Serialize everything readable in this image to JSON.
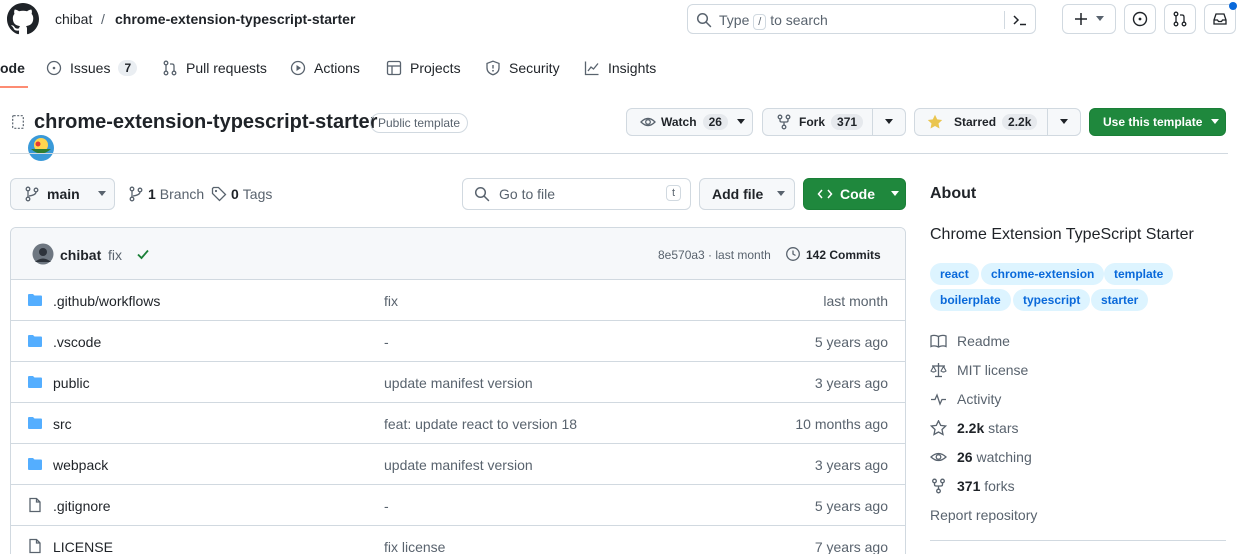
{
  "header": {
    "owner": "chibat",
    "separator": "/",
    "repo": "chrome-extension-typescript-starter",
    "search_prefix": "Type",
    "search_key": "/",
    "search_suffix": "to search"
  },
  "tabs": [
    {
      "label": "ode"
    },
    {
      "label": "Issues",
      "count": "7"
    },
    {
      "label": "Pull requests"
    },
    {
      "label": "Actions"
    },
    {
      "label": "Projects"
    },
    {
      "label": "Security"
    },
    {
      "label": "Insights"
    }
  ],
  "repo": {
    "title": "chrome-extension-typescript-starter",
    "visibility": "Public template",
    "watch_label": "Watch",
    "watch_count": "26",
    "fork_label": "Fork",
    "fork_count": "371",
    "star_label": "Starred",
    "star_count": "2.2k",
    "use_template": "Use this template"
  },
  "filenav": {
    "branch": "main",
    "branches_count": "1",
    "branches_label": "Branch",
    "tags_count": "0",
    "tags_label": "Tags",
    "goto_placeholder": "Go to file",
    "goto_key": "t",
    "add_file": "Add file",
    "code": "Code"
  },
  "commit": {
    "author": "chibat",
    "message": "fix",
    "hash_time": "8e570a3 · last month",
    "commits": "142 Commits"
  },
  "files": [
    {
      "type": "folder",
      "name": ".github/workflows",
      "message": "fix",
      "date": "last month"
    },
    {
      "type": "folder",
      "name": ".vscode",
      "message": "-",
      "date": "5 years ago"
    },
    {
      "type": "folder",
      "name": "public",
      "message": "update manifest version",
      "date": "3 years ago"
    },
    {
      "type": "folder",
      "name": "src",
      "message": "feat: update react to version 18",
      "date": "10 months ago"
    },
    {
      "type": "folder",
      "name": "webpack",
      "message": "update manifest version",
      "date": "3 years ago"
    },
    {
      "type": "file",
      "name": ".gitignore",
      "message": "-",
      "date": "5 years ago"
    },
    {
      "type": "file",
      "name": "LICENSE",
      "message": "fix license",
      "date": "7 years ago"
    }
  ],
  "about": {
    "heading": "About",
    "description": "Chrome Extension TypeScript Starter",
    "topics": [
      "react",
      "chrome-extension",
      "template",
      "boilerplate",
      "typescript",
      "starter"
    ],
    "readme": "Readme",
    "license": "MIT license",
    "activity": "Activity",
    "stars_count": "2.2k",
    "stars_label": "stars",
    "watching_count": "26",
    "watching_label": "watching",
    "forks_count": "371",
    "forks_label": "forks",
    "report": "Report repository"
  },
  "colors": {
    "accent_green": "#1f883d",
    "link_blue": "#0969da",
    "folder_blue": "#54aeff",
    "star_yellow": "#eac54f",
    "check_green": "#1a7f37"
  }
}
